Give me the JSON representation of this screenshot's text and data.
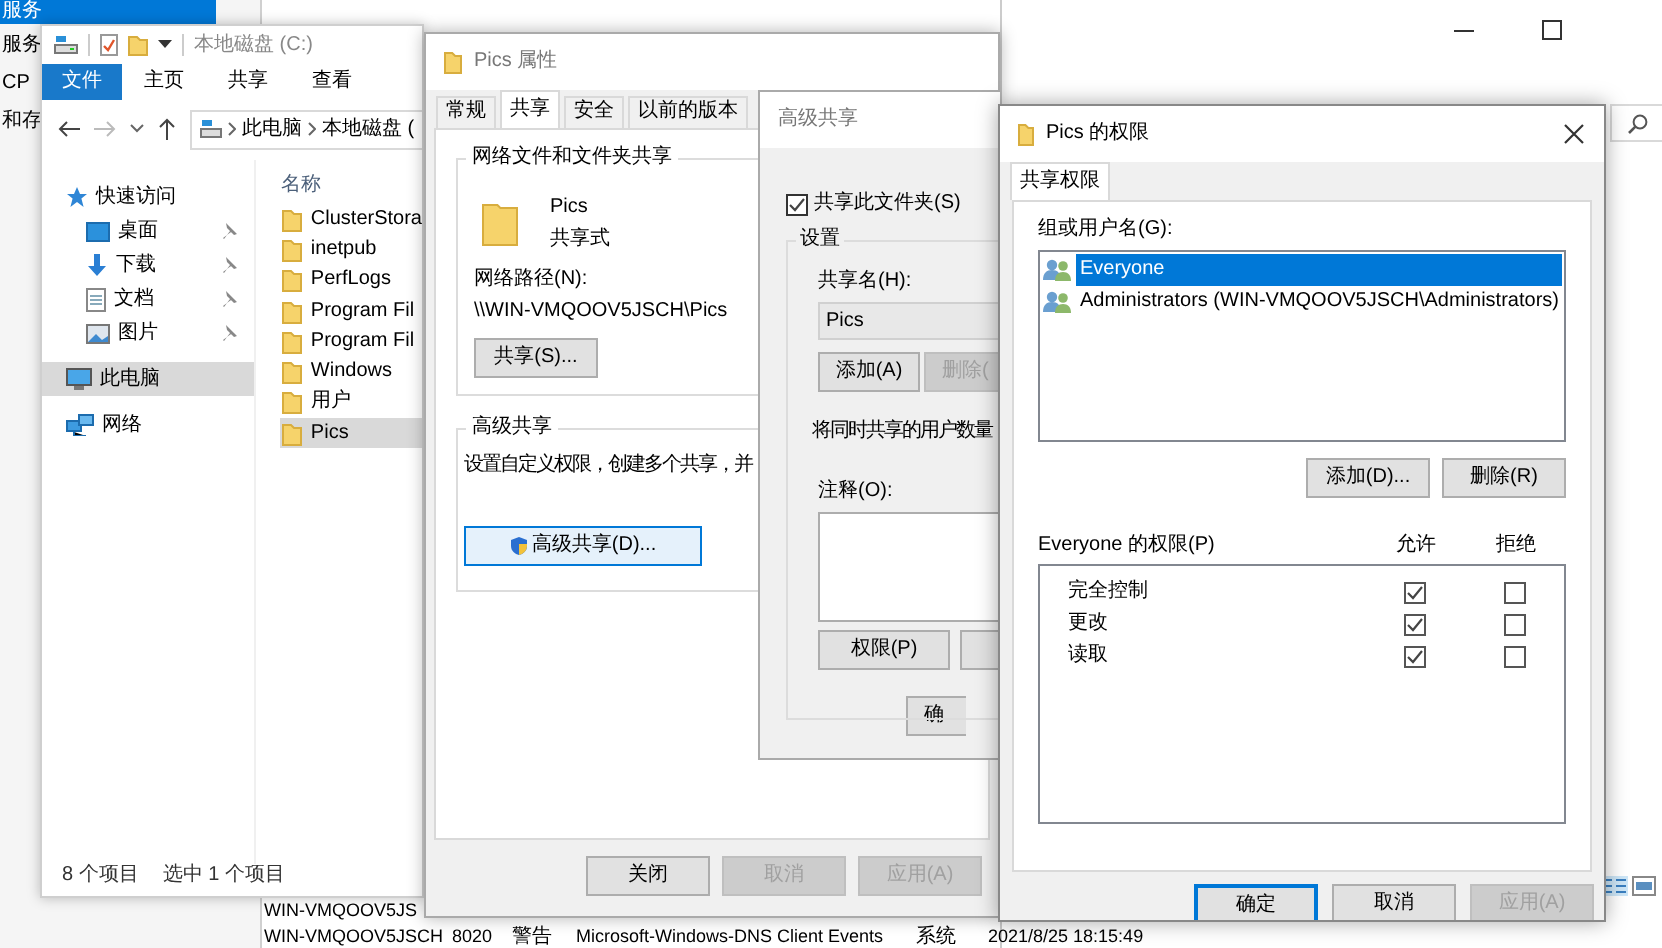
{
  "background_window": {
    "sidebar_items": [
      {
        "label": "服务",
        "selected": true
      },
      {
        "label": "服务",
        "selected": false
      },
      {
        "label": "CP",
        "selected": false
      },
      {
        "label": "和存",
        "selected": false
      }
    ],
    "event_rows": [
      {
        "cells": [
          "WIN-VMQOOV5JS"
        ]
      },
      {
        "cells": [
          "WIN-VMQOOV5JSCH",
          "8020",
          "警告",
          "Microsoft-Windows-DNS Client Events",
          "系统",
          "2021/8/25 18:15:49"
        ]
      }
    ]
  },
  "explorer": {
    "title": "本地磁盘 (C:)",
    "ribbon_tabs": [
      {
        "label": "文件",
        "selected": true
      },
      {
        "label": "主页",
        "selected": false
      },
      {
        "label": "共享",
        "selected": false
      },
      {
        "label": "查看",
        "selected": false
      }
    ],
    "breadcrumbs": [
      "此电脑",
      "本地磁盘 ("
    ],
    "nav": [
      {
        "label": "快速访问",
        "kind": "star",
        "selected": false,
        "children": [
          {
            "label": "桌面",
            "kind": "desktop",
            "pinned": true,
            "selected": false
          },
          {
            "label": "下载",
            "kind": "download",
            "pinned": true,
            "selected": false
          },
          {
            "label": "文档",
            "kind": "document",
            "pinned": true,
            "selected": false
          },
          {
            "label": "图片",
            "kind": "picture",
            "pinned": true,
            "selected": false
          }
        ]
      },
      {
        "label": "此电脑",
        "kind": "computer",
        "selected": true
      },
      {
        "label": "网络",
        "kind": "network",
        "selected": false
      }
    ],
    "column": "名称",
    "files": [
      {
        "name": "ClusterStora",
        "selected": false
      },
      {
        "name": "inetpub",
        "selected": false
      },
      {
        "name": "PerfLogs",
        "selected": false
      },
      {
        "name": "Program Fil",
        "selected": false
      },
      {
        "name": "Program Fil",
        "selected": false
      },
      {
        "name": "Windows",
        "selected": false
      },
      {
        "name": "用户",
        "selected": false
      },
      {
        "name": "Pics",
        "selected": true
      }
    ],
    "status": [
      "8 个项目",
      "选中 1 个项目"
    ]
  },
  "properties": {
    "title": "Pics 属性",
    "tabs": [
      {
        "label": "常规",
        "selected": false
      },
      {
        "label": "共享",
        "selected": true
      },
      {
        "label": "安全",
        "selected": false
      },
      {
        "label": "以前的版本",
        "selected": false
      }
    ],
    "share_group": {
      "title": "网络文件和文件夹共享",
      "folder": "Pics",
      "state": "共享式",
      "path_label": "网络路径(N):",
      "path": "\\\\WIN-VMQOOV5JSCH\\Pics",
      "button": "共享(S)..."
    },
    "advanced_group": {
      "title": "高级共享",
      "description": "设置自定义权限，创建多个共享，并",
      "button": "高级共享(D)..."
    },
    "buttons": [
      {
        "label": "关闭",
        "disabled": false
      },
      {
        "label": "取消",
        "disabled": true
      },
      {
        "label": "应用(A)",
        "disabled": true
      }
    ]
  },
  "advanced_sharing": {
    "title": "高级共享",
    "share_folder": {
      "label": "共享此文件夹(S)",
      "checked": true
    },
    "settings_title": "设置",
    "share_name_label": "共享名(H):",
    "share_name": "Pics",
    "name_buttons": [
      {
        "label": "添加(A)",
        "disabled": false
      },
      {
        "label": "删除(",
        "disabled": true
      }
    ],
    "limit_text": "将同时共享的用户数量",
    "comment_label": "注释(O):",
    "permissions_button": "权限(P)",
    "ok_button": "确"
  },
  "permissions": {
    "title": "Pics 的权限",
    "tabs": [
      {
        "label": "共享权限",
        "selected": true
      }
    ],
    "principals_label": "组或用户名(G):",
    "principals": [
      {
        "name": "Everyone",
        "selected": true
      },
      {
        "name": "Administrators (WIN-VMQOOV5JSCH\\Administrators)",
        "selected": false
      }
    ],
    "principal_buttons": [
      "添加(D)...",
      "删除(R)"
    ],
    "permissions_label": "Everyone 的权限(P)",
    "allow_header": "允许",
    "deny_header": "拒绝",
    "entries": [
      {
        "name": "完全控制",
        "allow": true,
        "deny": false
      },
      {
        "name": "更改",
        "allow": true,
        "deny": false
      },
      {
        "name": "读取",
        "allow": true,
        "deny": false
      }
    ],
    "buttons": [
      {
        "label": "确定",
        "disabled": false,
        "default": true
      },
      {
        "label": "取消",
        "disabled": false,
        "default": false
      },
      {
        "label": "应用(A)",
        "disabled": true,
        "default": false
      }
    ]
  }
}
